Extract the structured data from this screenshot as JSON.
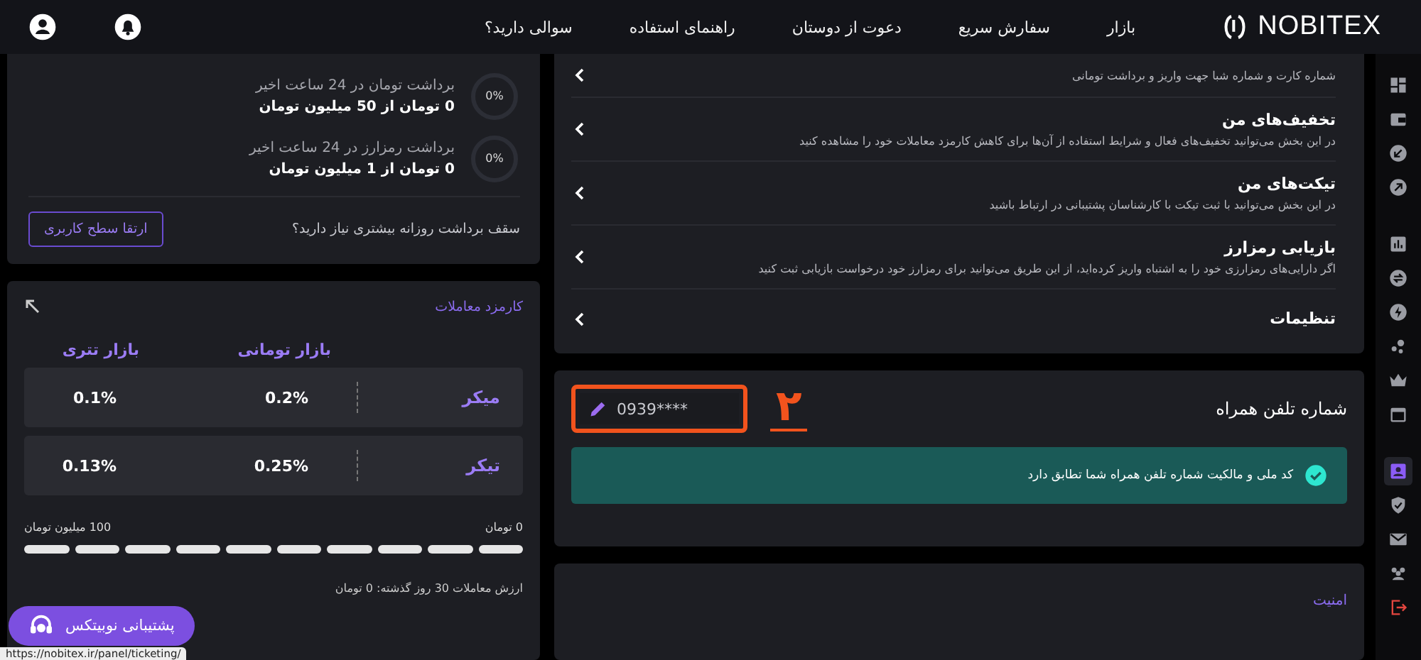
{
  "header": {
    "logo": "NOBITEX",
    "nav": [
      "بازار",
      "سفارش سریع",
      "دعوت از دوستان",
      "راهنمای استفاده",
      "سوالی دارید؟"
    ]
  },
  "sidebar": {
    "groups": [
      {
        "items": [
          {
            "kind": "dashboard",
            "selected": false
          },
          {
            "kind": "wallet",
            "selected": false
          },
          {
            "kind": "deposit",
            "selected": false
          },
          {
            "kind": "withdraw",
            "selected": false
          }
        ]
      },
      {
        "items": [
          {
            "kind": "chart",
            "selected": false
          },
          {
            "kind": "exchange",
            "selected": false
          },
          {
            "kind": "bolt",
            "selected": false
          },
          {
            "kind": "dots",
            "selected": false
          },
          {
            "kind": "crown",
            "selected": false
          },
          {
            "kind": "calendar",
            "selected": false
          }
        ]
      },
      {
        "items": [
          {
            "kind": "profile",
            "selected": true
          },
          {
            "kind": "shield",
            "selected": false
          },
          {
            "kind": "mail",
            "selected": false
          },
          {
            "kind": "people",
            "selected": false
          },
          {
            "kind": "logout",
            "selected": false
          }
        ]
      }
    ]
  },
  "limits": {
    "rows": [
      {
        "percent": "0%",
        "title": "برداشت تومان در 24 ساعت اخیر",
        "value": "0 تومان از 50 میلیون تومان"
      },
      {
        "percent": "0%",
        "title": "برداشت رمزارز در 24 ساعت اخیر",
        "value": "0 تومان از 1 میلیون تومان"
      }
    ],
    "question": "سقف برداشت روزانه بیشتری نیاز دارید؟",
    "button": "ارتقا سطح کاربری"
  },
  "fees": {
    "title": "کارمزد معاملات",
    "columns": [
      "بازار تومانی",
      "بازار تتری"
    ],
    "rows": [
      {
        "label": "میکر",
        "toman": "0.2%",
        "tether": "0.1%"
      },
      {
        "label": "تیکر",
        "toman": "0.25%",
        "tether": "0.13%"
      }
    ],
    "range_start": "0 تومان",
    "range_end": "100 میلیون تومان",
    "volume": "ارزش معاملات 30 روز گذشته: 0 تومان"
  },
  "menu": {
    "items": [
      {
        "description": "شماره کارت و شماره شبا جهت واریز و برداشت تومانی"
      },
      {
        "title": "تخفیف‌های من",
        "description": "در این بخش می‌توانید تخفیف‌های فعال و شرایط استفاده از آن‌ها برای کاهش کارمزد معاملات خود را مشاهده کنید"
      },
      {
        "title": "تیکت‌های من",
        "description": "در این بخش می‌توانید با ثبت تیکت با کارشناسان پشتیبانی در ارتباط باشید"
      },
      {
        "title": "بازیابی رمزارز",
        "description": "اگر دارایی‌های رمزارزی خود را به اشتباه واریز کرده‌اید، از این طریق می‌توانید برای رمزارز خود درخواست بازیابی ثبت کنید"
      },
      {
        "title": "تنظیمات"
      }
    ]
  },
  "phone": {
    "title": "شماره تلفن همراه",
    "value": "0939****",
    "annotation": "۲",
    "alert": "کد ملی و مالکیت شماره تلفن همراه شما تطابق دارد"
  },
  "security": {
    "title": "امنیت"
  },
  "support_button": "پشتیبانی نوبیتکس",
  "status_url": "https://nobitex.ir/panel/ticketing/"
}
